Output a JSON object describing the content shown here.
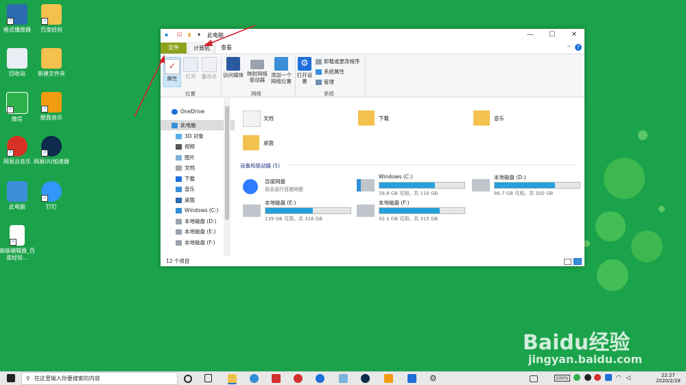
{
  "desktop": {
    "icons": [
      {
        "label": "格式播放器",
        "color": "#2b6cb0"
      },
      {
        "label": "百度经验",
        "color": "#f2c14e"
      },
      {
        "label": "回收站",
        "color": "#e8eef3"
      },
      {
        "label": "新建文件夹",
        "color": "#f2c14e"
      },
      {
        "label": "微信",
        "color": "#2fb149"
      },
      {
        "label": "酷我音乐",
        "color": "#f39c12"
      },
      {
        "label": "网易云音乐",
        "color": "#d93025"
      },
      {
        "label": "网易UU加速器",
        "color": "#0d2b4a"
      },
      {
        "label": "此电脑",
        "color": "#3a8fd8"
      },
      {
        "label": "钉钉",
        "color": "#3296fa"
      },
      {
        "label": "高级编辑器_百度经验...",
        "color": "#ffffff"
      }
    ]
  },
  "window": {
    "title": "此电脑",
    "controls": {
      "minimize": "—",
      "maximize": "☐",
      "close": "✕"
    },
    "ribbon_tabs": [
      {
        "label": "文件"
      },
      {
        "label": "计算机"
      },
      {
        "label": "查看"
      }
    ],
    "ribbon": {
      "location_group": {
        "label": "位置",
        "buttons": [
          {
            "label": "属性"
          },
          {
            "label": "打开"
          },
          {
            "label": "重命名"
          }
        ]
      },
      "network_group": {
        "label": "网络",
        "buttons": [
          {
            "label": "访问媒体"
          },
          {
            "label": "映射网络驱动器"
          },
          {
            "label": "添加一个网络位置"
          }
        ]
      },
      "system_group": {
        "label": "系统",
        "open_settings": "打开设置",
        "commands": [
          {
            "label": "卸载或更改程序"
          },
          {
            "label": "系统属性"
          },
          {
            "label": "管理"
          }
        ]
      }
    },
    "nav": [
      {
        "label": "OneDrive"
      },
      {
        "label": "此电脑"
      },
      {
        "label": "3D 对象"
      },
      {
        "label": "视频"
      },
      {
        "label": "图片"
      },
      {
        "label": "文档"
      },
      {
        "label": "下载"
      },
      {
        "label": "音乐"
      },
      {
        "label": "桌面"
      },
      {
        "label": "Windows (C:)"
      },
      {
        "label": "本地磁盘 (D:)"
      },
      {
        "label": "本地磁盘 (E:)"
      },
      {
        "label": "本地磁盘 (F:)"
      }
    ],
    "folders": [
      {
        "label": "文档"
      },
      {
        "label": "下载"
      },
      {
        "label": "音乐"
      },
      {
        "label": "桌面"
      }
    ],
    "devices_header": "设备和驱动器 (5)",
    "baidu": {
      "name": "百度网盘",
      "desc": "双击运行百度网盘"
    },
    "drives": [
      {
        "name": "Windows (C:)",
        "detail": "38.8 GB 可用，共 110 GB",
        "used_fraction": 0.65
      },
      {
        "name": "本地磁盘 (D:)",
        "detail": "86.7 GB 可用，共 300 GB",
        "used_fraction": 0.71
      },
      {
        "name": "本地磁盘 (E:)",
        "detail": "139 GB 可用，共 316 GB",
        "used_fraction": 0.56
      },
      {
        "name": "本地磁盘 (F:)",
        "detail": "92.1 GB 可用，共 315 GB",
        "used_fraction": 0.71
      }
    ],
    "status": "12 个项目"
  },
  "taskbar": {
    "search_placeholder": "在这里输入你要搜索的内容",
    "battery": "100%",
    "time": "22:27",
    "date": "2020/2/18"
  },
  "watermark": {
    "line1": "Baidu经验",
    "line2": "jingyan.baidu.com"
  },
  "colors": {
    "desktop": "#1ba34b",
    "file_tab": "#8ca11c",
    "drive_bar": "#26a0da",
    "arrow": "#d3202b"
  }
}
